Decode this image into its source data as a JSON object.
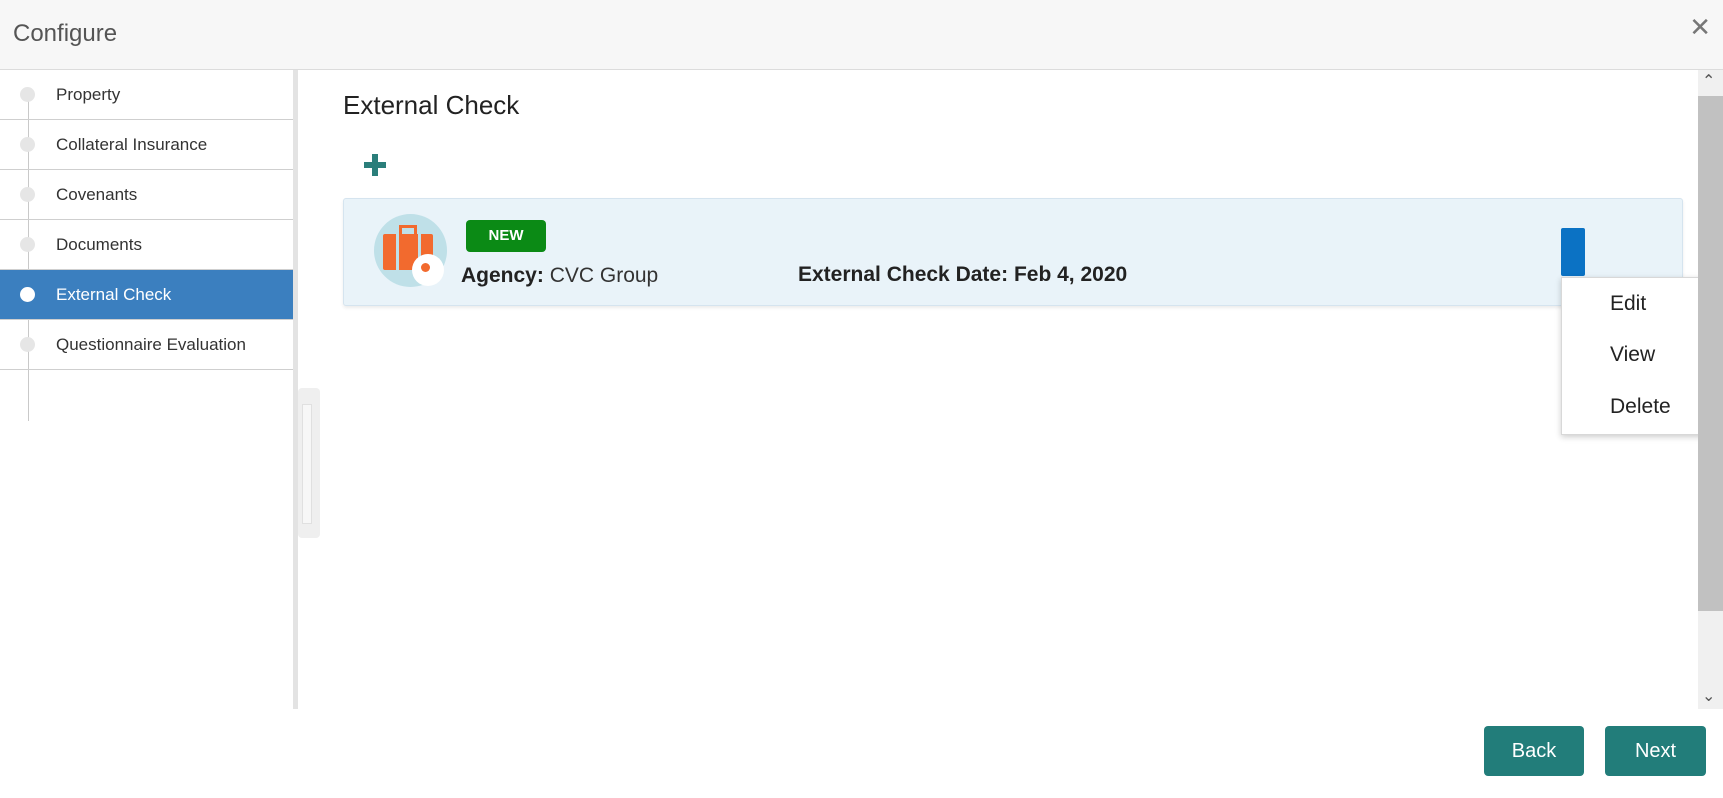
{
  "header": {
    "title": "Configure",
    "close_icon": "close-icon"
  },
  "sidebar": {
    "items": [
      {
        "label": "Property",
        "active": false
      },
      {
        "label": "Collateral Insurance",
        "active": false
      },
      {
        "label": "Covenants",
        "active": false
      },
      {
        "label": "Documents",
        "active": false
      },
      {
        "label": "External Check",
        "active": true
      },
      {
        "label": "Questionnaire Evaluation",
        "active": false
      }
    ]
  },
  "main": {
    "title": "External Check",
    "add_icon": "plus-icon",
    "card": {
      "badge": "NEW",
      "agency_label": "Agency:",
      "agency_value": "CVC Group",
      "date_label": "External Check Date:",
      "date_value": "Feb 4, 2020",
      "icon": "briefcase-gear-icon"
    },
    "menu": {
      "options": [
        "Edit",
        "View",
        "Delete"
      ]
    }
  },
  "footer": {
    "back_label": "Back",
    "next_label": "Next"
  },
  "colors": {
    "accent": "#227d7a",
    "active_nav": "#3b7fbf",
    "badge_new": "#0b8a15",
    "menu_button": "#0b72c4"
  }
}
